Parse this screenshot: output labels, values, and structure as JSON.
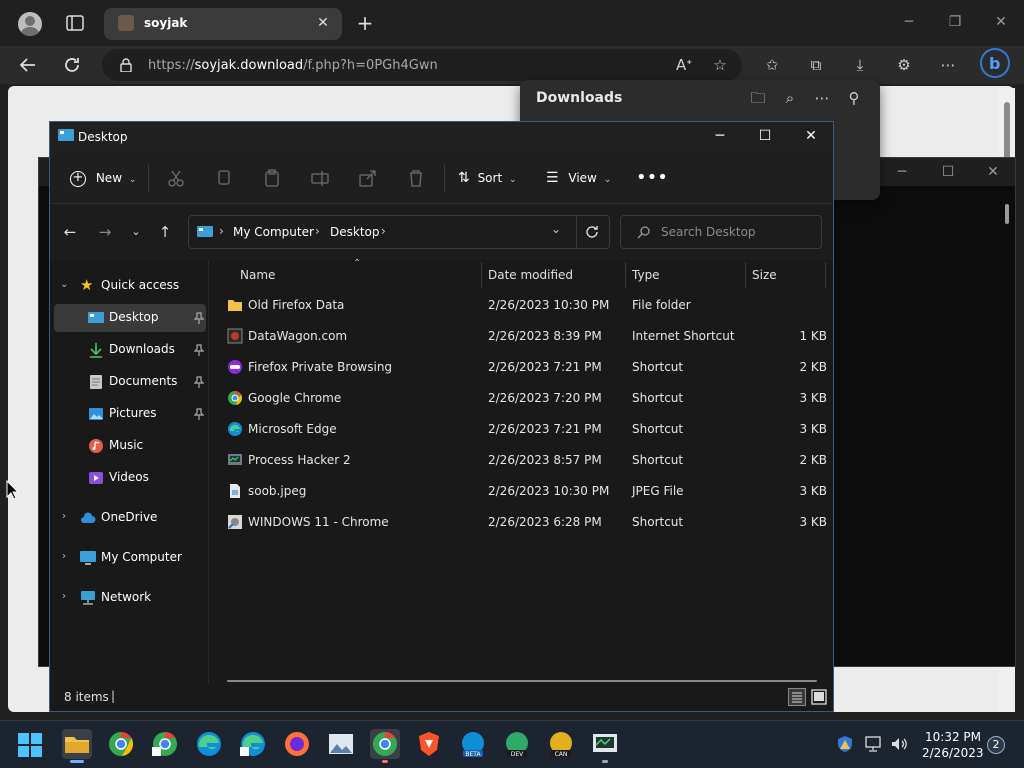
{
  "browser": {
    "tab_title": "soyjak",
    "url_prefix": "https://",
    "url_domain": "soyjak.download",
    "url_path": "/f.php?h=0PGh4Gwn",
    "downloads_title": "Downloads"
  },
  "explorer": {
    "window_title": "Desktop",
    "cmd": {
      "new": "New",
      "sort": "Sort",
      "view": "View"
    },
    "breadcrumb": [
      "My Computer",
      "Desktop"
    ],
    "search_placeholder": "Search Desktop",
    "nav": {
      "quick_access": "Quick access",
      "items": [
        "Desktop",
        "Downloads",
        "Documents",
        "Pictures",
        "Music",
        "Videos"
      ],
      "onedrive": "OneDrive",
      "my_computer": "My Computer",
      "network": "Network"
    },
    "columns": [
      "Name",
      "Date modified",
      "Type",
      "Size"
    ],
    "files": [
      {
        "name": "Old Firefox Data",
        "date": "2/26/2023 10:30 PM",
        "type": "File folder",
        "size": ""
      },
      {
        "name": "DataWagon.com",
        "date": "2/26/2023 8:39 PM",
        "type": "Internet Shortcut",
        "size": "1 KB"
      },
      {
        "name": "Firefox Private Browsing",
        "date": "2/26/2023 7:21 PM",
        "type": "Shortcut",
        "size": "2 KB"
      },
      {
        "name": "Google Chrome",
        "date": "2/26/2023 7:20 PM",
        "type": "Shortcut",
        "size": "3 KB"
      },
      {
        "name": "Microsoft Edge",
        "date": "2/26/2023 7:21 PM",
        "type": "Shortcut",
        "size": "3 KB"
      },
      {
        "name": "Process Hacker 2",
        "date": "2/26/2023 8:57 PM",
        "type": "Shortcut",
        "size": "2 KB"
      },
      {
        "name": "soob.jpeg",
        "date": "2/26/2023 10:30 PM",
        "type": "JPEG File",
        "size": "3 KB"
      },
      {
        "name": "WINDOWS 11 - Chrome",
        "date": "2/26/2023 6:28 PM",
        "type": "Shortcut",
        "size": "3 KB"
      }
    ],
    "status": "8 items"
  },
  "taskbar": {
    "time": "10:32 PM",
    "date": "2/26/2023",
    "notifications": "2"
  },
  "colors": {
    "accent": "#0078d4",
    "folder": "#f2c14e"
  }
}
